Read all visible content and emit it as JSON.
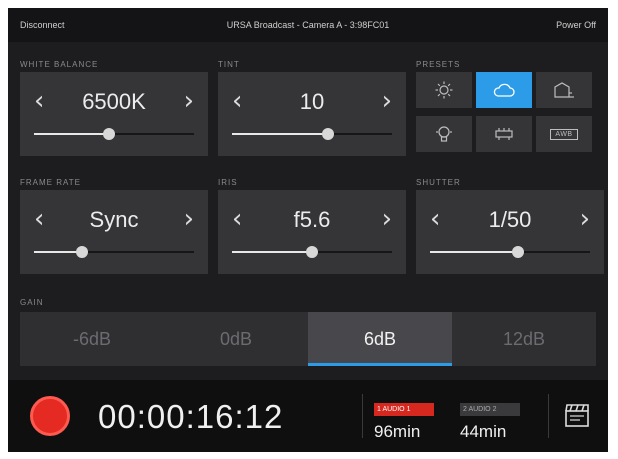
{
  "topbar": {
    "left": "Disconnect",
    "title": "URSA Broadcast - Camera A - 3:98FC01",
    "right": "Power Off"
  },
  "sections": {
    "white_balance": {
      "label": "WHITE BALANCE",
      "value": "6500K",
      "level": 0.47
    },
    "tint": {
      "label": "TINT",
      "value": "10",
      "level": 0.6
    },
    "presets": {
      "label": "PRESETS",
      "items": [
        "sun-icon",
        "cloud-icon",
        "shade-icon",
        "tungsten-icon",
        "fluorescent-icon",
        "awb-icon"
      ],
      "active_index": 1,
      "awb_text": "AWB"
    },
    "frame_rate": {
      "label": "FRAME RATE",
      "value": "Sync",
      "level": 0.3
    },
    "iris": {
      "label": "IRIS",
      "value": "f5.6",
      "level": 0.5
    },
    "shutter": {
      "label": "SHUTTER",
      "value": "1/50",
      "level": 0.55
    }
  },
  "gain": {
    "label": "GAIN",
    "options": [
      "-6dB",
      "0dB",
      "6dB",
      "12dB"
    ],
    "active_index": 2
  },
  "bottom": {
    "timecode": "00:00:16:12",
    "slot1": {
      "tag": "1 AUDIO 1",
      "remaining": "96min"
    },
    "slot2": {
      "tag": "2 AUDIO 2",
      "remaining": "44min"
    }
  },
  "colors": {
    "accent": "#2c9ce8",
    "record": "#e42a22",
    "panel": "#353538",
    "background": "#1d1d1f"
  }
}
